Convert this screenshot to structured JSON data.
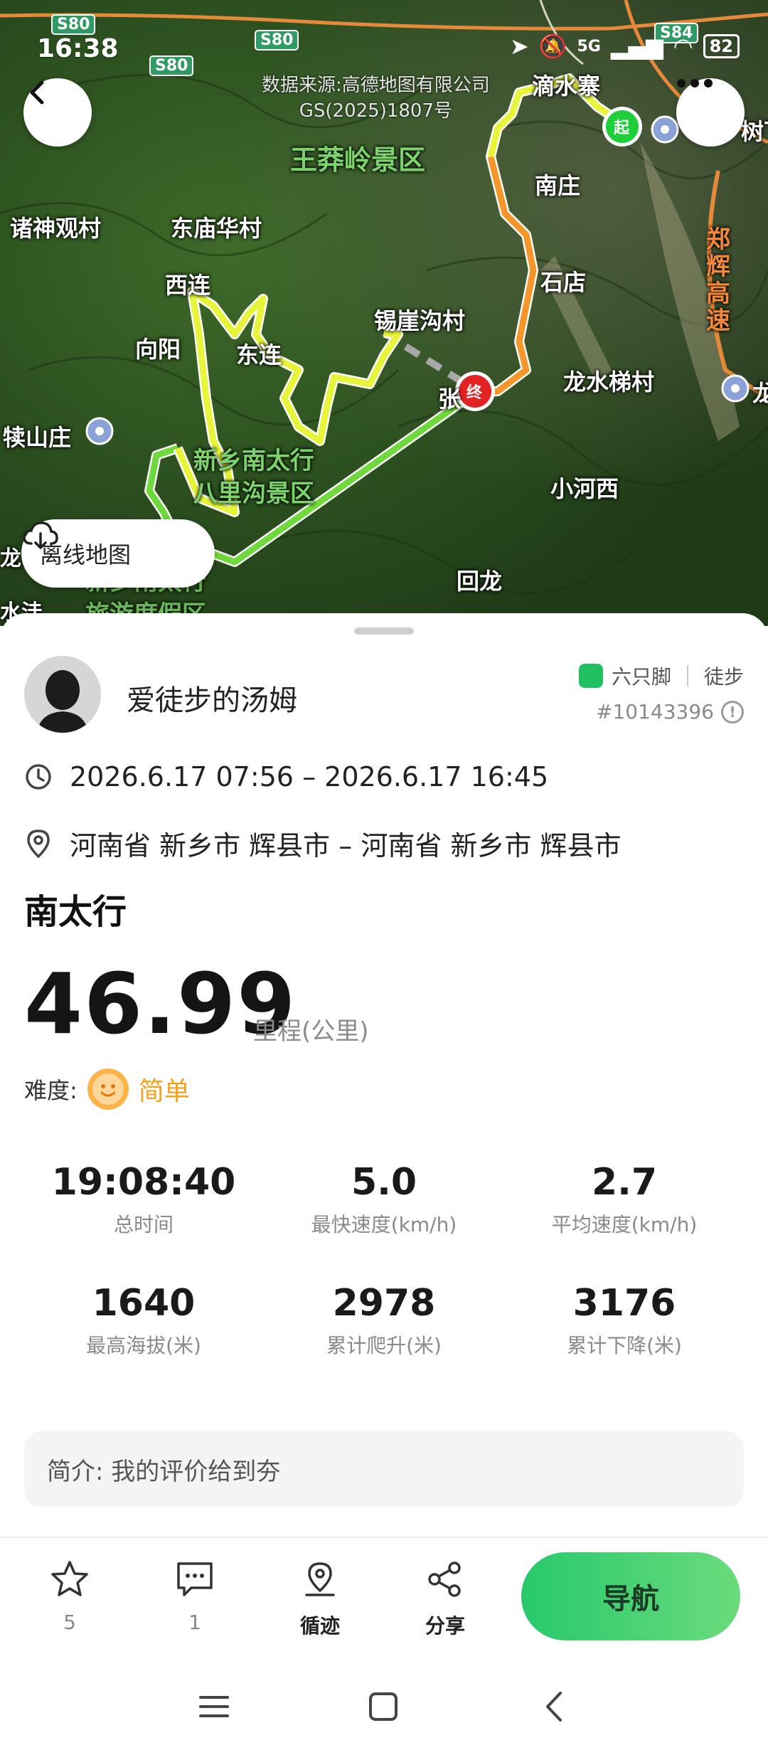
{
  "status_bar": {
    "time": "16:38",
    "battery": "82",
    "network": "5G"
  },
  "map": {
    "credit_line1": "数据来源:高德地图有限公司",
    "credit_line2": "GS(2025)1807号",
    "road_badges": [
      "S80",
      "S80",
      "S80",
      "S84"
    ],
    "scenic_labels": [
      "王莽岭景区",
      "新乡南太行",
      "八里沟景区",
      "新乡南太行",
      "旅游度假区"
    ],
    "place_labels": [
      "滴水寨",
      "南庄",
      "诸神观村",
      "东庙华村",
      "石店",
      "西连",
      "锡崖沟村",
      "向阳",
      "东连",
      "龙水梯村",
      "犊山庄",
      "张",
      "小河西",
      "回龙",
      "郑辉高速",
      "树下",
      "龙",
      "水洼",
      "龙"
    ],
    "start_marker": "起",
    "end_marker": "终",
    "offline_label": "离线地图",
    "route_colors": {
      "green": "#6fd83c",
      "yellow": "#e6f53a",
      "orange": "#f5962a",
      "dashed": "#9a9a9a"
    }
  },
  "profile": {
    "username": "爱徒步的汤姆",
    "brand": "六只脚",
    "activity_type": "徒步",
    "track_id": "#10143396"
  },
  "trip": {
    "time_range": "2026.6.17 07:56 – 2026.6.17 16:45",
    "location": "河南省 新乡市 辉县市 – 河南省 新乡市 辉县市",
    "title": "南太行",
    "distance": "46.99",
    "distance_unit": "里程(公里)",
    "difficulty_label": "难度:",
    "difficulty": "简单"
  },
  "stats": [
    {
      "value": "19:08:40",
      "label": "总时间"
    },
    {
      "value": "5.0",
      "label": "最快速度(km/h)"
    },
    {
      "value": "2.7",
      "label": "平均速度(km/h)"
    },
    {
      "value": "1640",
      "label": "最高海拔(米)"
    },
    {
      "value": "2978",
      "label": "累计爬升(米)"
    },
    {
      "value": "3176",
      "label": "累计下降(米)"
    }
  ],
  "intro": "简介: 我的评价给到夯",
  "actions": {
    "favorite_count": "5",
    "comment_count": "1",
    "follow_track": "循迹",
    "share": "分享",
    "navigate": "导航"
  }
}
